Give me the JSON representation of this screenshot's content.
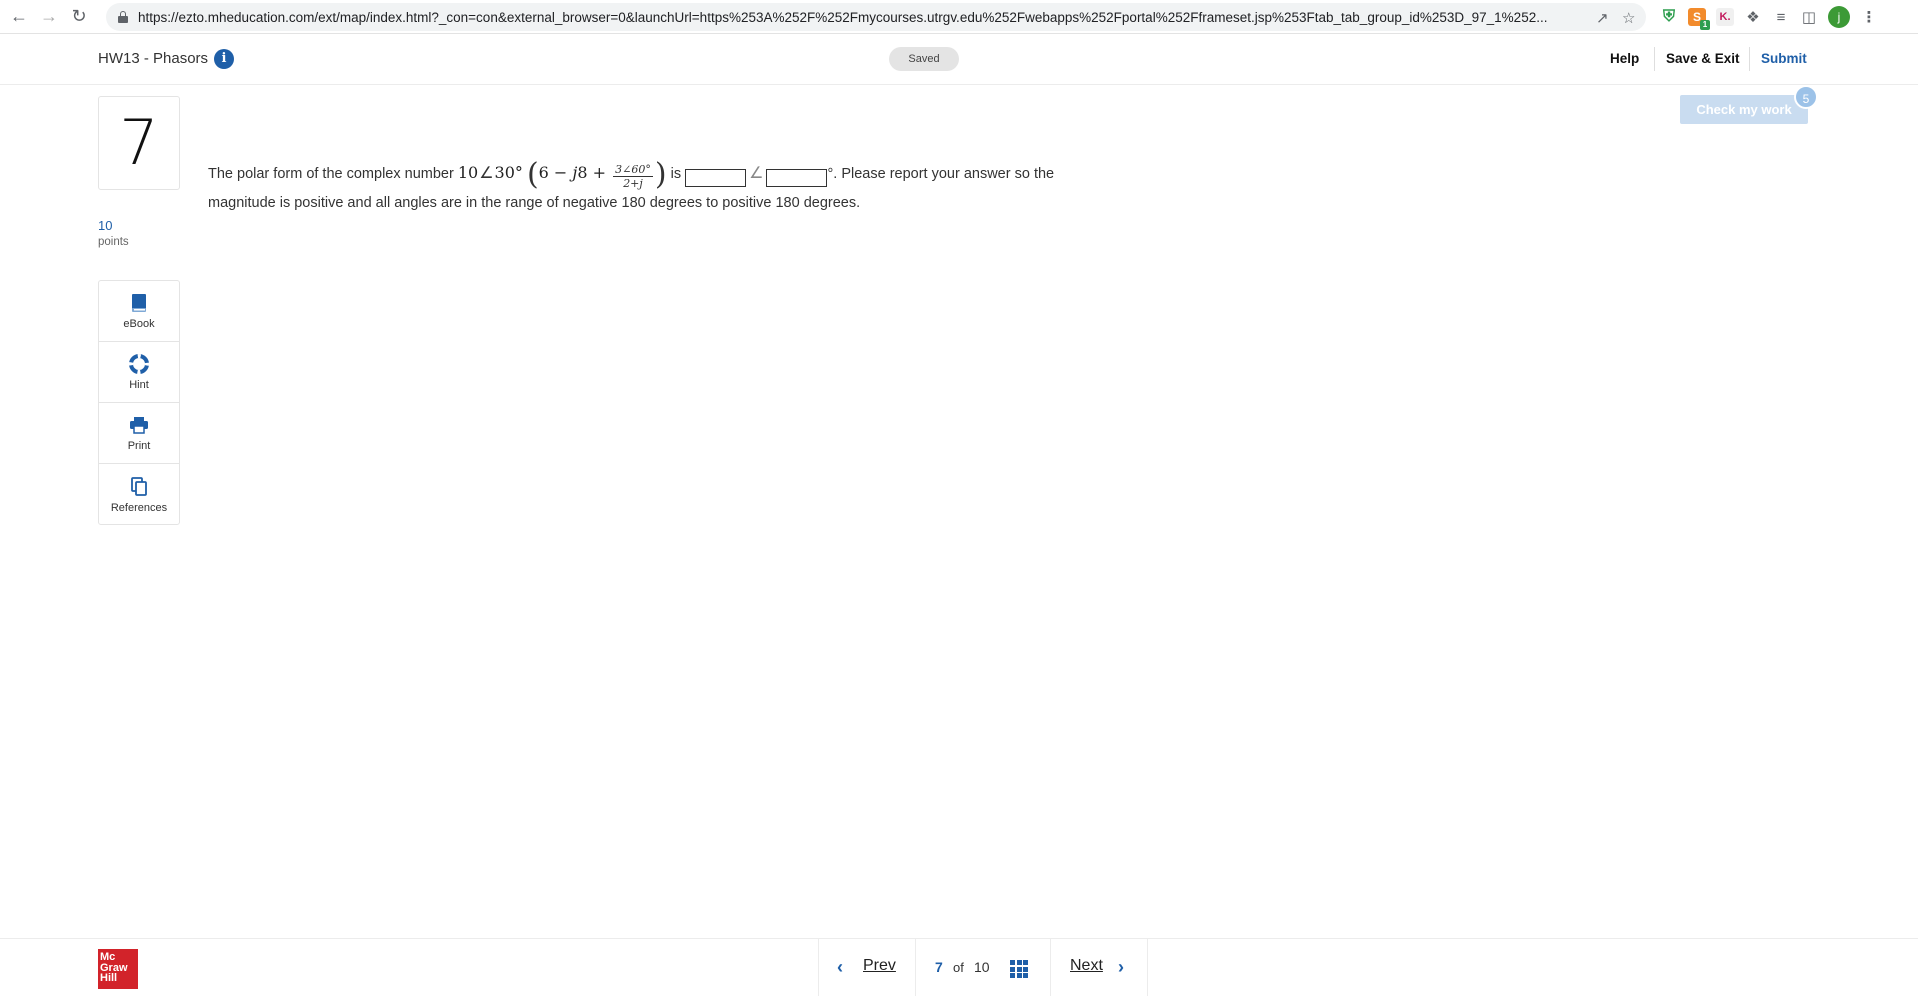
{
  "browser": {
    "url": "https://ezto.mheducation.com/ext/map/index.html?_con=con&external_browser=0&launchUrl=https%253A%252F%252Fmycourses.utrgv.edu%252Fwebapps%252Fportal%252Fframeset.jsp%253Ftab_tab_group_id%253D_97_1%252...",
    "profile_initial": "j",
    "ext_badge": "1",
    "ext_k": "K."
  },
  "header": {
    "assignment_title": "HW13 - Phasors",
    "saved_label": "Saved",
    "help_label": "Help",
    "save_exit_label": "Save & Exit",
    "submit_label": "Submit"
  },
  "question": {
    "number": "7",
    "points_value": "10",
    "points_label": "points",
    "text_before": "The polar form of the complex number ",
    "math": {
      "magnitude": "10",
      "angle": "30°",
      "inner_a": "6",
      "inner_minus": " − ",
      "inner_j": "j",
      "inner_b": "8",
      "inner_plus": " + ",
      "frac_num": "3∠60°",
      "frac_den": "2+j"
    },
    "text_is": " is ",
    "answer_magnitude": "",
    "answer_angle": "",
    "text_after": "°. Please report your answer so the magnitude is positive and all angles are in the range of negative 180 degrees to positive 180 degrees."
  },
  "tools": [
    {
      "label": "eBook",
      "icon": "book-icon"
    },
    {
      "label": "Hint",
      "icon": "lifebuoy-icon"
    },
    {
      "label": "Print",
      "icon": "printer-icon"
    },
    {
      "label": "References",
      "icon": "copy-icon"
    }
  ],
  "check_work": {
    "label": "Check my work",
    "remaining": "5"
  },
  "footer": {
    "logo_lines": [
      "Mc",
      "Graw",
      "Hill"
    ],
    "prev_label": "Prev",
    "current_page": "7",
    "of_label": "of",
    "total_pages": "10",
    "next_label": "Next"
  },
  "colors": {
    "brand_blue": "#1f5fa8",
    "logo_red": "#d2232a",
    "check_disabled": "#c9dcf0"
  }
}
